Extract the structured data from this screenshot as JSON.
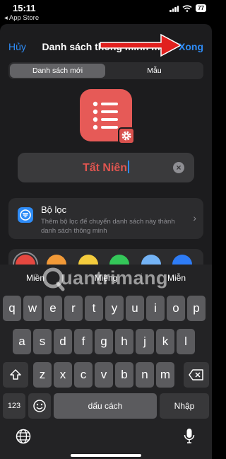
{
  "status_bar": {
    "time": "15:11",
    "back_label": "◂ App Store",
    "battery": "77"
  },
  "nav": {
    "cancel_label": "Hủy",
    "title": "Danh sách thông minh mới",
    "done_label": "Xong"
  },
  "segments": {
    "active": "Danh sách mới",
    "other": "Mẫu"
  },
  "list": {
    "icon": "list-bullet-icon",
    "color": "#e65a57",
    "name": "Tất Niên"
  },
  "filter": {
    "title": "Bộ lọc",
    "description": "Thêm bộ lọc để chuyển danh sách này thành danh sách thông minh"
  },
  "colors": [
    "#e64840",
    "#f29a38",
    "#f4cc3d",
    "#34c759",
    "#74b3f5",
    "#2e7cf6"
  ],
  "keyboard": {
    "suggestions": [
      "Miền",
      "Miệng",
      "Miễn"
    ],
    "row1": [
      "q",
      "w",
      "e",
      "r",
      "t",
      "y",
      "u",
      "i",
      "o",
      "p"
    ],
    "row2": [
      "a",
      "s",
      "d",
      "f",
      "g",
      "h",
      "j",
      "k",
      "l"
    ],
    "row3": [
      "z",
      "x",
      "c",
      "v",
      "b",
      "n",
      "m"
    ],
    "numbers_label": "123",
    "space_label": "dấu cách",
    "return_label": "Nhập"
  },
  "watermark": "uantrimang"
}
